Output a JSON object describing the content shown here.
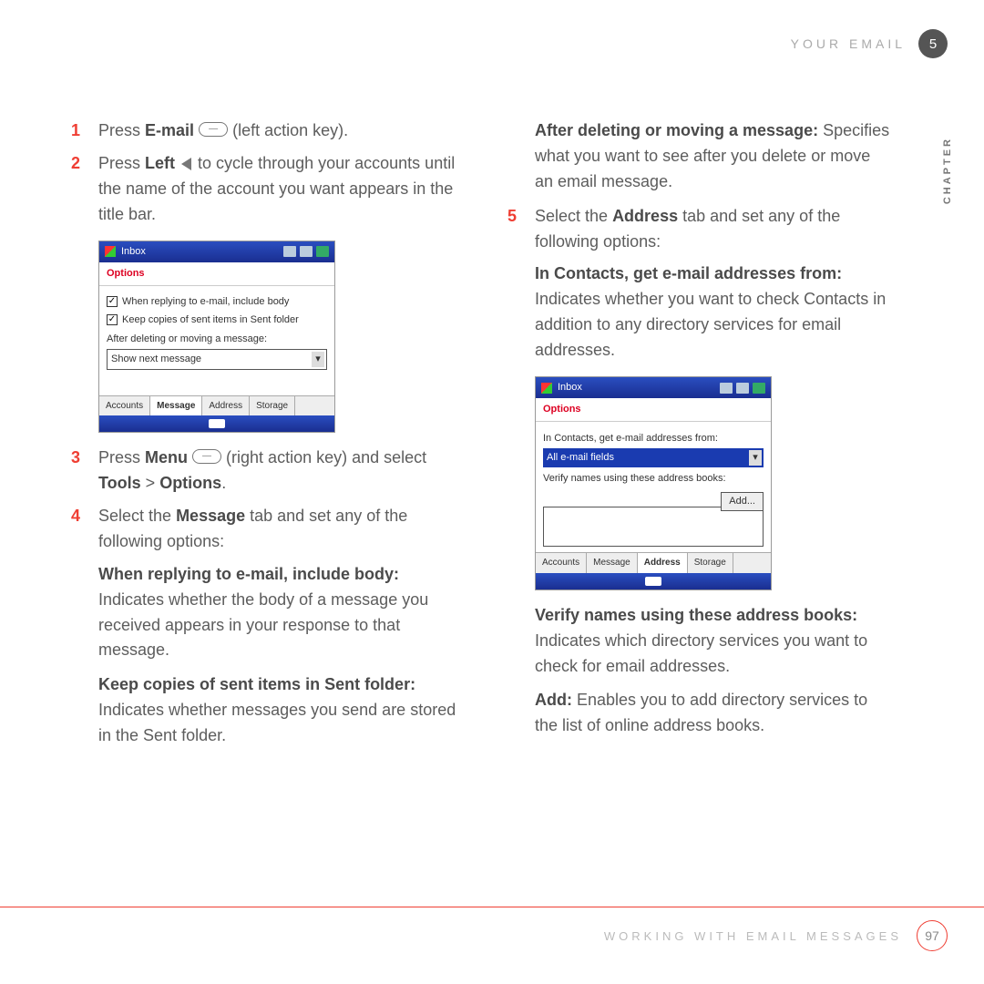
{
  "header": {
    "section": "YOUR EMAIL",
    "chapter_num": "5",
    "side_label": "CHAPTER"
  },
  "footer": {
    "label": "WORKING WITH EMAIL MESSAGES",
    "page": "97"
  },
  "left": {
    "s1": {
      "n": "1",
      "a": "Press ",
      "b": "E-mail",
      "c": " (left action key)."
    },
    "s2": {
      "n": "2",
      "a": "Press ",
      "b": "Left",
      "c": " to cycle through your accounts until the name of the account you want appears in the title bar."
    },
    "s3": {
      "n": "3",
      "a": "Press ",
      "b": "Menu",
      "c": " (right action key) and select ",
      "d": "Tools",
      "e": " > ",
      "f": "Options",
      "g": "."
    },
    "s4": {
      "n": "4",
      "a": "Select the ",
      "b": "Message",
      "c": " tab and set any of the following options:"
    },
    "p1": {
      "head": "When replying to e-mail, include body:",
      "body": " Indicates whether the body of a message you received appears in your response to that message."
    },
    "p2": {
      "head": "Keep copies of sent items in Sent folder:",
      "body": " Indicates whether messages you send are stored in the Sent folder."
    }
  },
  "right": {
    "p0": {
      "head": "After deleting or moving a message:",
      "body": " Specifies what you want to see after you delete or move an email message."
    },
    "s5": {
      "n": "5",
      "a": "Select the ",
      "b": "Address",
      "c": " tab and set any of the following options:"
    },
    "p1": {
      "head": "In Contacts, get e-mail addresses from:",
      "body": " Indicates whether you want to check Contacts in addition to any directory services for email addresses."
    },
    "p2": {
      "head": "Verify names using these address books:",
      "body": " Indicates which directory services you want to check for email addresses."
    },
    "p3": {
      "head": "Add:",
      "body": " Enables you to add directory services to the list of online address books."
    }
  },
  "dev1": {
    "title": "Inbox",
    "options": "Options",
    "chk1": "When replying to e-mail, include body",
    "chk2": "Keep copies of sent items in Sent folder",
    "lbl": "After deleting or moving a message:",
    "sel": "Show next message",
    "tabs": [
      "Accounts",
      "Message",
      "Address",
      "Storage"
    ],
    "active": 1
  },
  "dev2": {
    "title": "Inbox",
    "options": "Options",
    "lbl1": "In Contacts, get e-mail addresses from:",
    "sel": "All e-mail fields",
    "lbl2": "Verify names using these address books:",
    "add": "Add...",
    "tabs": [
      "Accounts",
      "Message",
      "Address",
      "Storage"
    ],
    "active": 2
  }
}
